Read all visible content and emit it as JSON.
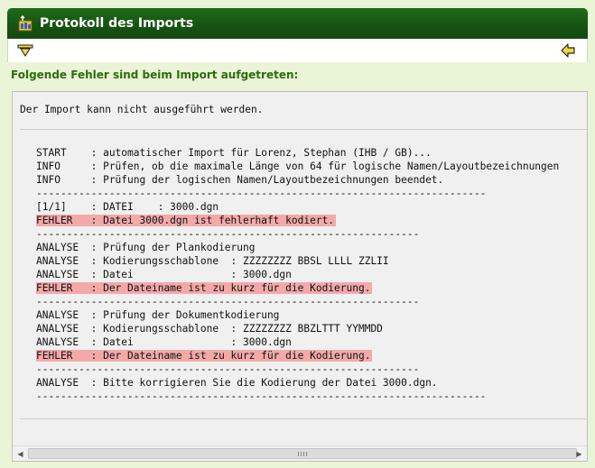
{
  "window": {
    "title": "Protokoll des Imports",
    "accent_color": "#1f6a1a",
    "icon": "import-icon"
  },
  "toolbar": {
    "left_icon": "download-arrow-icon",
    "right_icon": "back-arrow-icon"
  },
  "section": {
    "heading": "Folgende Fehler sind beim Import aufgetreten:"
  },
  "log": {
    "header": "Der Import kann nicht ausgeführt werden.",
    "highlight_color": "#f4a9a9",
    "lines": [
      {
        "text": "START    : automatischer Import für Lorenz, Stephan (IHB / GB)...",
        "error": false
      },
      {
        "text": "INFO     : Prüfen, ob die maximale Länge von 64 für logische Namen/Layoutbezeichnungen",
        "error": false
      },
      {
        "text": "INFO     : Prüfung der logischen Namen/Layoutbezeichnungen beendet.",
        "error": false
      },
      {
        "text": "--------------------------------------------------------------------------",
        "error": false
      },
      {
        "text": "[1/1]    : DATEI    : 3000.dgn",
        "error": false
      },
      {
        "text": "FEHLER   : Datei 3000.dgn ist fehlerhaft kodiert.",
        "error": true
      },
      {
        "text": "---------------------------------------------------------------",
        "error": false
      },
      {
        "text": "ANALYSE  : Prüfung der Plankodierung",
        "error": false
      },
      {
        "text": "ANALYSE  : Kodierungsschablone  : ZZZZZZZZ BBSL LLLL ZZLII",
        "error": false
      },
      {
        "text": "ANALYSE  : Datei                : 3000.dgn",
        "error": false
      },
      {
        "text": "FEHLER   : Der Dateiname ist zu kurz für die Kodierung.",
        "error": true
      },
      {
        "text": "---------------------------------------------------------------",
        "error": false
      },
      {
        "text": "ANALYSE  : Prüfung der Dokumentkodierung",
        "error": false
      },
      {
        "text": "ANALYSE  : Kodierungsschablone  : ZZZZZZZZ BBZLTTT YYMMDD",
        "error": false
      },
      {
        "text": "ANALYSE  : Datei                : 3000.dgn",
        "error": false
      },
      {
        "text": "FEHLER   : Der Dateiname ist zu kurz für die Kodierung.",
        "error": true
      },
      {
        "text": "---------------------------------------------------------------",
        "error": false
      },
      {
        "text": "ANALYSE  : Bitte korrigieren Sie die Kodierung der Datei 3000.dgn.",
        "error": false
      },
      {
        "text": "--------------------------------------------------------------------------",
        "error": false
      }
    ]
  }
}
